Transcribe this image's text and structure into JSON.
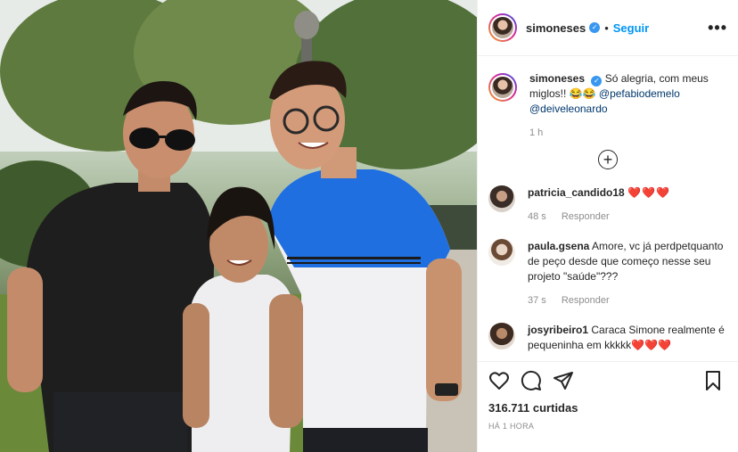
{
  "post": {
    "username": "simoneses",
    "follow_label": "Seguir",
    "separator": "•",
    "more_label": "•••",
    "caption_text": "Só alegria, com meus miglos!! 😂😂",
    "caption_mentions": [
      "@pefabiodemelo",
      "@deiveleonardo"
    ],
    "caption_time": "1 h",
    "load_more_label": "+"
  },
  "comments": [
    {
      "username": "patricia_candido18",
      "text": "❤️❤️❤️",
      "time": "48 s",
      "reply_label": "Responder"
    },
    {
      "username": "paula.gsena",
      "text": "Amore, vc já perdpetquanto de peço desde que começo nesse seu projeto \"saúde\"???",
      "time": "37 s",
      "reply_label": "Responder"
    },
    {
      "username": "josyribeiro1",
      "text": "Caraca Simone realmente é pequeninha em kkkkk❤️❤️❤️",
      "time": "",
      "reply_label": ""
    }
  ],
  "actions": {
    "likes": "316.711 curtidas",
    "posted": "HÁ 1 HORA"
  },
  "colors": {
    "link": "#0095f6",
    "verified": "#3897f0",
    "heart": "#e0245e"
  },
  "icons": [
    "heart-icon",
    "comment-icon",
    "share-icon",
    "bookmark-icon",
    "verified-icon",
    "plus-circle-icon"
  ]
}
